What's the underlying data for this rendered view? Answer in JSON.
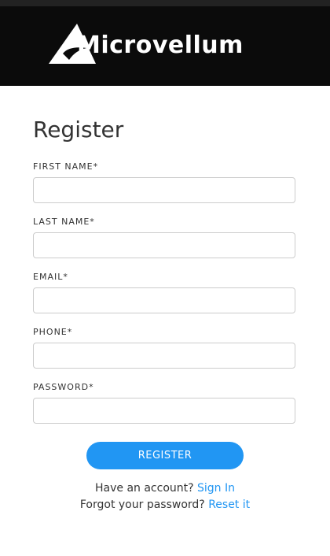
{
  "header": {
    "logo_text": "Microvellum"
  },
  "form": {
    "title": "Register",
    "fields": [
      {
        "label": "FIRST NAME*",
        "value": "",
        "placeholder": ""
      },
      {
        "label": "LAST NAME*",
        "value": "",
        "placeholder": ""
      },
      {
        "label": "EMAIL*",
        "value": "",
        "placeholder": ""
      },
      {
        "label": "PHONE*",
        "value": "",
        "placeholder": ""
      },
      {
        "label": "PASSWORD*",
        "value": "",
        "placeholder": ""
      }
    ],
    "submit_label": "REGISTER"
  },
  "footer": {
    "account_prompt": "Have an account?",
    "sign_in_link": "Sign In",
    "forgot_prompt": "Forgot your password?",
    "reset_link": "Reset it"
  },
  "colors": {
    "header_bg": "#0b0b0b",
    "accent": "#2196f3",
    "input_border": "#cccccc",
    "text": "#333333"
  },
  "icons": {
    "logo_mark": "microvellum-triangle-logo-icon"
  }
}
